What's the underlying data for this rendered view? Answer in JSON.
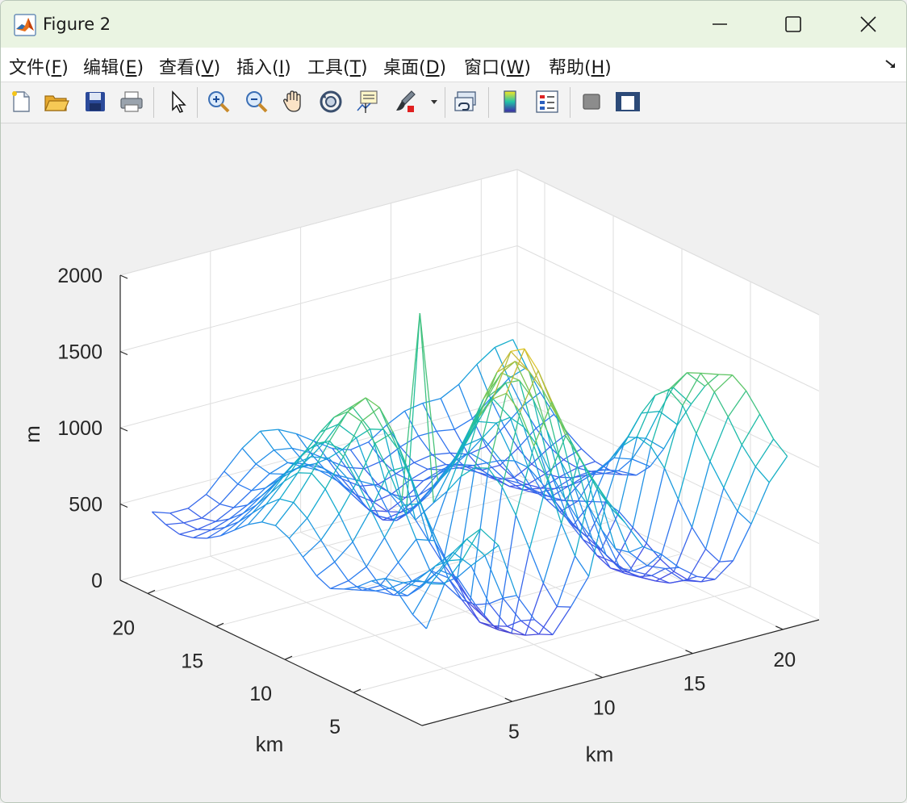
{
  "window": {
    "title": "Figure 2"
  },
  "menu": {
    "items": [
      {
        "text": "文件(",
        "key": "F",
        "end": ")"
      },
      {
        "text": "编辑(",
        "key": "E",
        "end": ")"
      },
      {
        "text": "查看(",
        "key": "V",
        "end": ")"
      },
      {
        "text": "插入(",
        "key": "I",
        "end": ")"
      },
      {
        "text": "工具(",
        "key": "T",
        "end": ")"
      },
      {
        "text": "桌面(",
        "key": "D",
        "end": ")"
      },
      {
        "text": "窗口(",
        "key": "W",
        "end": ")"
      },
      {
        "text": "帮助(",
        "key": "H",
        "end": ")"
      }
    ]
  },
  "toolbar": {
    "buttons": [
      "new-figure-icon",
      "open-file-icon",
      "save-icon",
      "print-icon",
      "edit-plot-arrow-icon",
      "zoom-in-icon",
      "zoom-out-icon",
      "pan-hand-icon",
      "rotate-3d-icon",
      "data-cursor-icon",
      "brush-icon",
      "link-plot-icon",
      "colorbar-icon",
      "legend-icon",
      "hide-plot-tools-icon",
      "show-plot-tools-icon"
    ]
  },
  "chart_data": {
    "type": "surface-mesh-3d",
    "title": "",
    "xlabel": "km",
    "ylabel": "km",
    "zlabel": "m",
    "xlim": [
      0,
      22
    ],
    "ylim": [
      0,
      22
    ],
    "zlim": [
      0,
      2000
    ],
    "xticks": [
      "5",
      "10",
      "15",
      "20"
    ],
    "yticks": [
      "5",
      "10",
      "15",
      "20"
    ],
    "zticks": [
      "0",
      "500",
      "1000",
      "1500",
      "2000"
    ],
    "grid": true,
    "colormap": "parula",
    "z_grid": [
      [
        560,
        820,
        950,
        1120,
        980,
        620,
        430,
        300,
        450,
        620,
        1090,
        910,
        720,
        640,
        520,
        430,
        380,
        470,
        680,
        920,
        1060
      ],
      [
        610,
        780,
        900,
        1010,
        870,
        560,
        380,
        260,
        410,
        710,
        1180,
        960,
        640,
        520,
        470,
        360,
        320,
        420,
        720,
        980,
        1130
      ],
      [
        700,
        760,
        820,
        880,
        760,
        480,
        300,
        210,
        520,
        880,
        1280,
        1040,
        620,
        440,
        380,
        300,
        290,
        460,
        830,
        1080,
        1250
      ],
      [
        760,
        700,
        640,
        720,
        640,
        430,
        260,
        180,
        700,
        1120,
        1380,
        1160,
        700,
        420,
        330,
        270,
        300,
        560,
        960,
        1220,
        1360
      ],
      [
        700,
        620,
        540,
        600,
        560,
        420,
        240,
        160,
        880,
        1300,
        1560,
        1280,
        820,
        460,
        310,
        250,
        340,
        700,
        1100,
        1340,
        1420
      ],
      [
        620,
        560,
        500,
        560,
        600,
        520,
        340,
        200,
        1020,
        1480,
        1720,
        1400,
        900,
        520,
        300,
        240,
        400,
        860,
        1240,
        1420,
        1380
      ],
      [
        560,
        520,
        520,
        640,
        760,
        720,
        480,
        260,
        1100,
        1560,
        1820,
        1520,
        1020,
        600,
        340,
        260,
        460,
        960,
        1300,
        1380,
        1260
      ],
      [
        520,
        540,
        600,
        760,
        940,
        920,
        620,
        340,
        1060,
        1480,
        1760,
        1600,
        1180,
        700,
        400,
        300,
        520,
        980,
        1220,
        1240,
        1100
      ],
      [
        560,
        620,
        720,
        900,
        1120,
        1120,
        780,
        420,
        960,
        1320,
        1580,
        1620,
        1340,
        820,
        470,
        340,
        540,
        880,
        1060,
        1040,
        920
      ],
      [
        640,
        720,
        860,
        1040,
        1260,
        1300,
        960,
        520,
        820,
        1100,
        1360,
        1500,
        1420,
        960,
        560,
        380,
        500,
        740,
        860,
        820,
        720
      ],
      [
        720,
        820,
        980,
        1160,
        1360,
        1420,
        1120,
        620,
        700,
        900,
        1120,
        1300,
        1360,
        1040,
        640,
        420,
        460,
        620,
        680,
        640,
        560
      ],
      [
        760,
        880,
        1040,
        1220,
        1380,
        1440,
        1200,
        700,
        1900,
        760,
        900,
        1080,
        1220,
        1060,
        700,
        460,
        420,
        520,
        560,
        520,
        460
      ],
      [
        740,
        860,
        1000,
        1160,
        1300,
        1340,
        1160,
        720,
        540,
        620,
        720,
        860,
        1020,
        980,
        700,
        480,
        400,
        440,
        480,
        460,
        420
      ],
      [
        680,
        780,
        900,
        1040,
        1160,
        1180,
        1060,
        720,
        460,
        480,
        560,
        680,
        820,
        840,
        660,
        480,
        380,
        380,
        420,
        430,
        410
      ],
      [
        600,
        680,
        780,
        900,
        1000,
        1020,
        940,
        700,
        440,
        380,
        440,
        540,
        660,
        700,
        600,
        460,
        360,
        340,
        380,
        410,
        420
      ],
      [
        520,
        580,
        660,
        760,
        860,
        880,
        840,
        680,
        460,
        340,
        360,
        440,
        540,
        580,
        540,
        440,
        340,
        320,
        360,
        420,
        460
      ],
      [
        460,
        500,
        560,
        640,
        720,
        760,
        760,
        660,
        500,
        360,
        320,
        380,
        460,
        500,
        480,
        420,
        340,
        320,
        380,
        460,
        520
      ],
      [
        420,
        440,
        480,
        540,
        620,
        680,
        700,
        640,
        540,
        420,
        340,
        360,
        420,
        460,
        460,
        420,
        360,
        360,
        440,
        540,
        600
      ],
      [
        400,
        400,
        420,
        480,
        560,
        640,
        680,
        640,
        580,
        480,
        400,
        380,
        420,
        460,
        480,
        460,
        420,
        440,
        540,
        640,
        700
      ],
      [
        420,
        400,
        400,
        460,
        560,
        660,
        720,
        700,
        640,
        560,
        480,
        440,
        460,
        520,
        560,
        560,
        540,
        580,
        680,
        780,
        820
      ],
      [
        460,
        420,
        420,
        480,
        600,
        720,
        800,
        780,
        720,
        640,
        560,
        520,
        540,
        620,
        680,
        700,
        700,
        760,
        860,
        940,
        960
      ]
    ]
  }
}
